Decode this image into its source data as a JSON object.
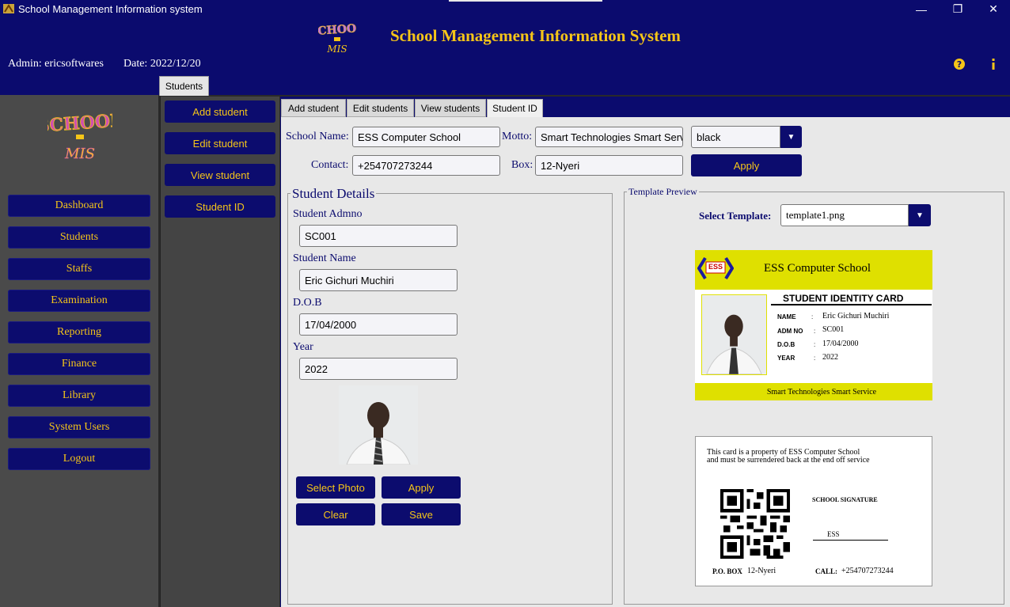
{
  "window": {
    "title": "School Management Information system",
    "controls": {
      "minimize": "—",
      "maximize": "❐",
      "close": "✕"
    }
  },
  "header": {
    "system_title": "School Management Information System",
    "admin_text": "Admin: ericsoftwares",
    "date_text": "Date: 2022/12/20",
    "icons": [
      "help-icon",
      "info-icon"
    ]
  },
  "top_tab": "Students",
  "sidebar": {
    "items": [
      "Dashboard",
      "Students",
      "Staffs",
      "Examination",
      "Reporting",
      "Finance",
      "Library",
      "System Users",
      "Logout"
    ]
  },
  "subnav": {
    "items": [
      "Add student",
      "Edit student",
      "View student",
      "Student ID"
    ]
  },
  "main_tabs": [
    "Add student",
    "Edit students",
    "View students",
    "Student ID"
  ],
  "school_form": {
    "school_name_label": "School Name:",
    "school_name_value": "ESS Computer School",
    "motto_label": "Motto:",
    "motto_value": "Smart Technologies Smart Service",
    "color_value": "black",
    "contact_label": "Contact:",
    "contact_value": "+254707273244",
    "box_label": "Box:",
    "box_value": "12-Nyeri",
    "apply_label": "Apply"
  },
  "student_details": {
    "legend": "Student Details",
    "admno_label": "Student Admno",
    "admno_value": "SC001",
    "name_label": "Student Name",
    "name_value": "Eric Gichuri Muchiri",
    "dob_label": "D.O.B",
    "dob_value": "17/04/2000",
    "year_label": "Year",
    "year_value": "2022",
    "buttons": {
      "select_photo": "Select Photo",
      "apply": "Apply",
      "clear": "Clear",
      "save": "Save"
    }
  },
  "template_preview": {
    "legend": "Template Preview",
    "select_label": "Select Template:",
    "select_value": "template1.png",
    "front": {
      "logo_text": "ESS",
      "school_name": "ESS Computer School",
      "card_title": "STUDENT IDENTITY CARD",
      "rows": [
        {
          "label": "NAME",
          "value": "Eric Gichuri Muchiri"
        },
        {
          "label": "ADM NO",
          "value": "SC001"
        },
        {
          "label": "D.O.B",
          "value": "17/04/2000"
        },
        {
          "label": "YEAR",
          "value": "2022"
        }
      ],
      "motto": "Smart Technologies Smart Service",
      "colors": {
        "band": "#dfe000"
      }
    },
    "back": {
      "notice_line1": "This card is a property of ESS Computer School",
      "notice_line2": "and must be surrendered back at the end off service",
      "signature_label": "SCHOOL SIGNATURE",
      "signature_value": "ESS",
      "box_label": "P.O. BOX",
      "box_value": "12-Nyeri",
      "call_label": "CALL:",
      "call_value": "+254707273244"
    }
  },
  "colors": {
    "navy": "#0b0b6e",
    "gold": "#f5c518",
    "sidebar": "#4a4a4a"
  }
}
